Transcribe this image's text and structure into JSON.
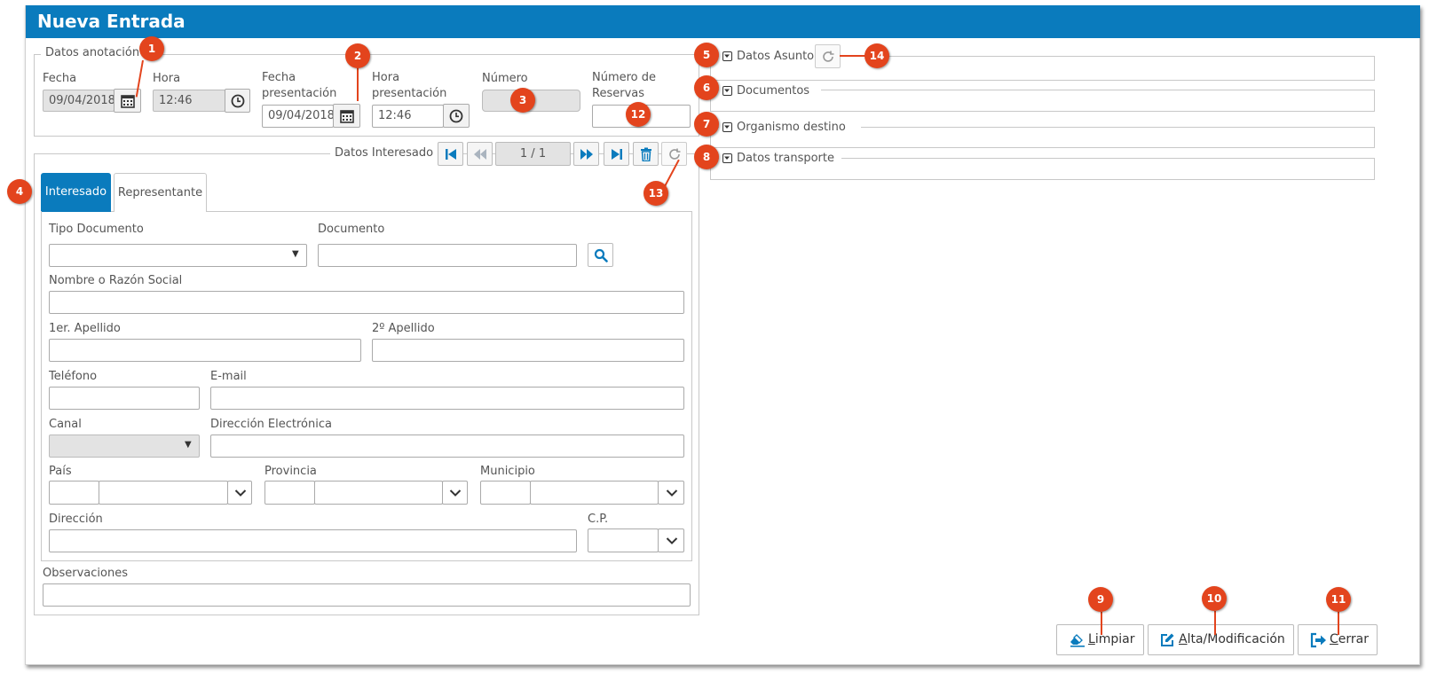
{
  "window": {
    "title": "Nueva Entrada"
  },
  "datos_anotacion": {
    "legend": "Datos anotación",
    "fecha_label": "Fecha",
    "fecha_value": "09/04/2018",
    "hora_label": "Hora",
    "hora_value": "12:46",
    "fecha_presentacion_label_1": "Fecha",
    "fecha_presentacion_label_2": "presentación",
    "fecha_presentacion_value": "09/04/2018",
    "hora_presentacion_label_1": "Hora",
    "hora_presentacion_label_2": "presentación",
    "hora_presentacion_value": "12:46",
    "numero_label": "Número",
    "numero_value": "",
    "num_reservas_label_1": "Número de",
    "num_reservas_label_2": "Reservas",
    "num_reservas_value": ""
  },
  "sections": {
    "datos_asunto": "Datos Asunto",
    "documentos": "Documentos",
    "organismo_destino": "Organismo destino",
    "datos_transporte": "Datos transporte"
  },
  "interesado": {
    "legend": "Datos Interesado",
    "pager": "1 / 1",
    "tabs": [
      "Interesado",
      "Representante"
    ],
    "tipo_documento_label": "Tipo Documento",
    "tipo_documento_value": "",
    "documento_label": "Documento",
    "documento_value": "",
    "nombre_label": "Nombre o Razón Social",
    "nombre_value": "",
    "apellido1_label": "1er. Apellido",
    "apellido1_value": "",
    "apellido2_label": "2º Apellido",
    "apellido2_value": "",
    "telefono_label": "Teléfono",
    "telefono_value": "",
    "email_label": "E-mail",
    "email_value": "",
    "canal_label": "Canal",
    "canal_value": "",
    "direccion_electronica_label": "Dirección Electrónica",
    "direccion_electronica_value": "",
    "pais_label": "País",
    "provincia_label": "Provincia",
    "municipio_label": "Municipio",
    "direccion_label": "Dirección",
    "direccion_value": "",
    "cp_label": "C.P.",
    "observaciones_label": "Observaciones",
    "observaciones_value": ""
  },
  "actions": {
    "limpiar": {
      "mnemonic": "L",
      "rest": "impiar"
    },
    "alta": {
      "mnemonic": "A",
      "rest": "lta/Modificación"
    },
    "cerrar": {
      "mnemonic": "C",
      "rest": "errar"
    }
  },
  "callouts": [
    "1",
    "2",
    "3",
    "4",
    "5",
    "6",
    "7",
    "8",
    "9",
    "10",
    "11",
    "12",
    "13",
    "14"
  ],
  "colors": {
    "header": "#0a7bbd",
    "callout": "#e3441d",
    "icon_blue": "#0a7bbd"
  }
}
